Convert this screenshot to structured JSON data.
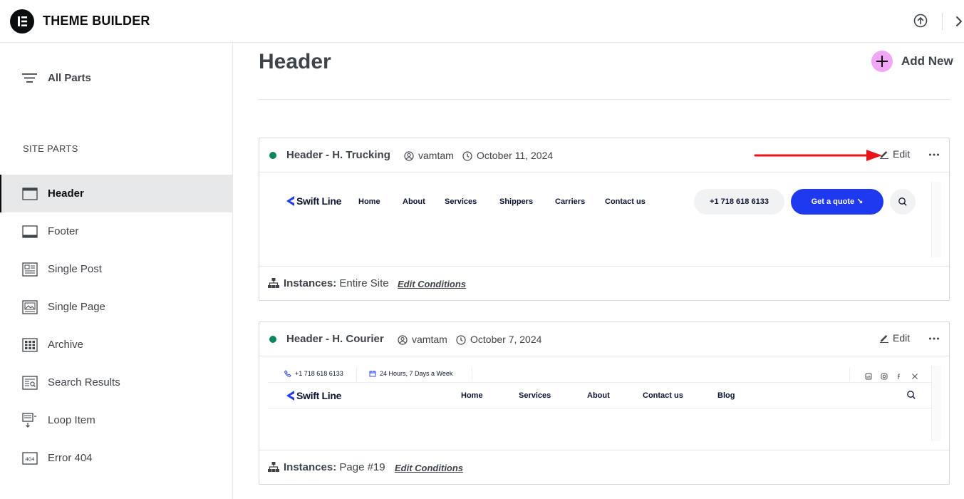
{
  "app": {
    "title": "THEME BUILDER"
  },
  "sidebar": {
    "all_parts_label": "All Parts",
    "section_title": "SITE PARTS",
    "items": [
      {
        "label": "Header",
        "icon": "header-icon",
        "active": true
      },
      {
        "label": "Footer",
        "icon": "footer-icon",
        "active": false
      },
      {
        "label": "Single Post",
        "icon": "single-post-icon",
        "active": false
      },
      {
        "label": "Single Page",
        "icon": "single-page-icon",
        "active": false
      },
      {
        "label": "Archive",
        "icon": "archive-icon",
        "active": false
      },
      {
        "label": "Search Results",
        "icon": "search-results-icon",
        "active": false
      },
      {
        "label": "Loop Item",
        "icon": "loop-item-icon",
        "active": false
      },
      {
        "label": "Error 404",
        "icon": "error-404-icon",
        "active": false
      }
    ]
  },
  "main": {
    "title": "Header",
    "add_new_label": "Add New",
    "cards": [
      {
        "title": "Header - H. Trucking",
        "author": "vamtam",
        "date": "October 11, 2024",
        "edit_label": "Edit",
        "status": "active",
        "instances_label": "Instances:",
        "instances_value": "Entire Site",
        "edit_conditions_label": "Edit Conditions",
        "preview": {
          "brand": "Swift Line",
          "nav": [
            "Home",
            "About",
            "Services",
            "Shippers",
            "Carriers",
            "Contact us"
          ],
          "phone": "+1 718 618 6133",
          "cta": "Get a quote ↘"
        }
      },
      {
        "title": "Header - H. Courier",
        "author": "vamtam",
        "date": "October 7, 2024",
        "edit_label": "Edit",
        "status": "active",
        "instances_label": "Instances:",
        "instances_value": "Page #19",
        "edit_conditions_label": "Edit Conditions",
        "preview": {
          "topbar_phone": "+1 718 618 6133",
          "topbar_hours": "24 Hours, 7 Days a Week",
          "brand": "Swift Line",
          "nav": [
            "Home",
            "Services",
            "About",
            "Contact us",
            "Blog"
          ]
        }
      }
    ]
  },
  "colors": {
    "accent_plus": "#f1a7f6",
    "status_green": "#0a875a",
    "cta_blue": "#1f39f0",
    "annotation_red": "#e8141c",
    "active_item_bg": "#e6e8ea"
  }
}
